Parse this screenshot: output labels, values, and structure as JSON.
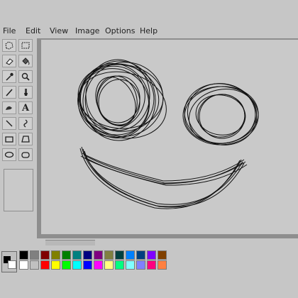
{
  "menu": {
    "items": [
      {
        "label": "File"
      },
      {
        "label": "Edit"
      },
      {
        "label": "View"
      },
      {
        "label": "Image"
      },
      {
        "label": "Options"
      },
      {
        "label": "Help"
      }
    ]
  },
  "tools": [
    {
      "name": "free-form-select-icon"
    },
    {
      "name": "select-icon"
    },
    {
      "name": "eraser-icon"
    },
    {
      "name": "fill-bucket-icon"
    },
    {
      "name": "color-picker-icon"
    },
    {
      "name": "magnifier-icon"
    },
    {
      "name": "pencil-icon"
    },
    {
      "name": "brush-icon"
    },
    {
      "name": "airbrush-icon"
    },
    {
      "name": "text-icon"
    },
    {
      "name": "line-icon"
    },
    {
      "name": "curve-icon"
    },
    {
      "name": "rectangle-icon"
    },
    {
      "name": "polygon-icon"
    },
    {
      "name": "ellipse-icon"
    },
    {
      "name": "rounded-rectangle-icon"
    }
  ],
  "text_tool_glyph": "A",
  "palette": {
    "top_row": [
      "#000000",
      "#808080",
      "#800000",
      "#808000",
      "#008000",
      "#008080",
      "#000080",
      "#800080",
      "#808040",
      "#004040",
      "#0080ff",
      "#004080",
      "#8000ff",
      "#804000"
    ],
    "bottom_row": [
      "#ffffff",
      "#c0c0c0",
      "#ff0000",
      "#ffff00",
      "#00ff00",
      "#00ffff",
      "#0000ff",
      "#ff00ff",
      "#ffff80",
      "#00ff80",
      "#80ffff",
      "#8080ff",
      "#ff0080",
      "#ff8040"
    ]
  }
}
